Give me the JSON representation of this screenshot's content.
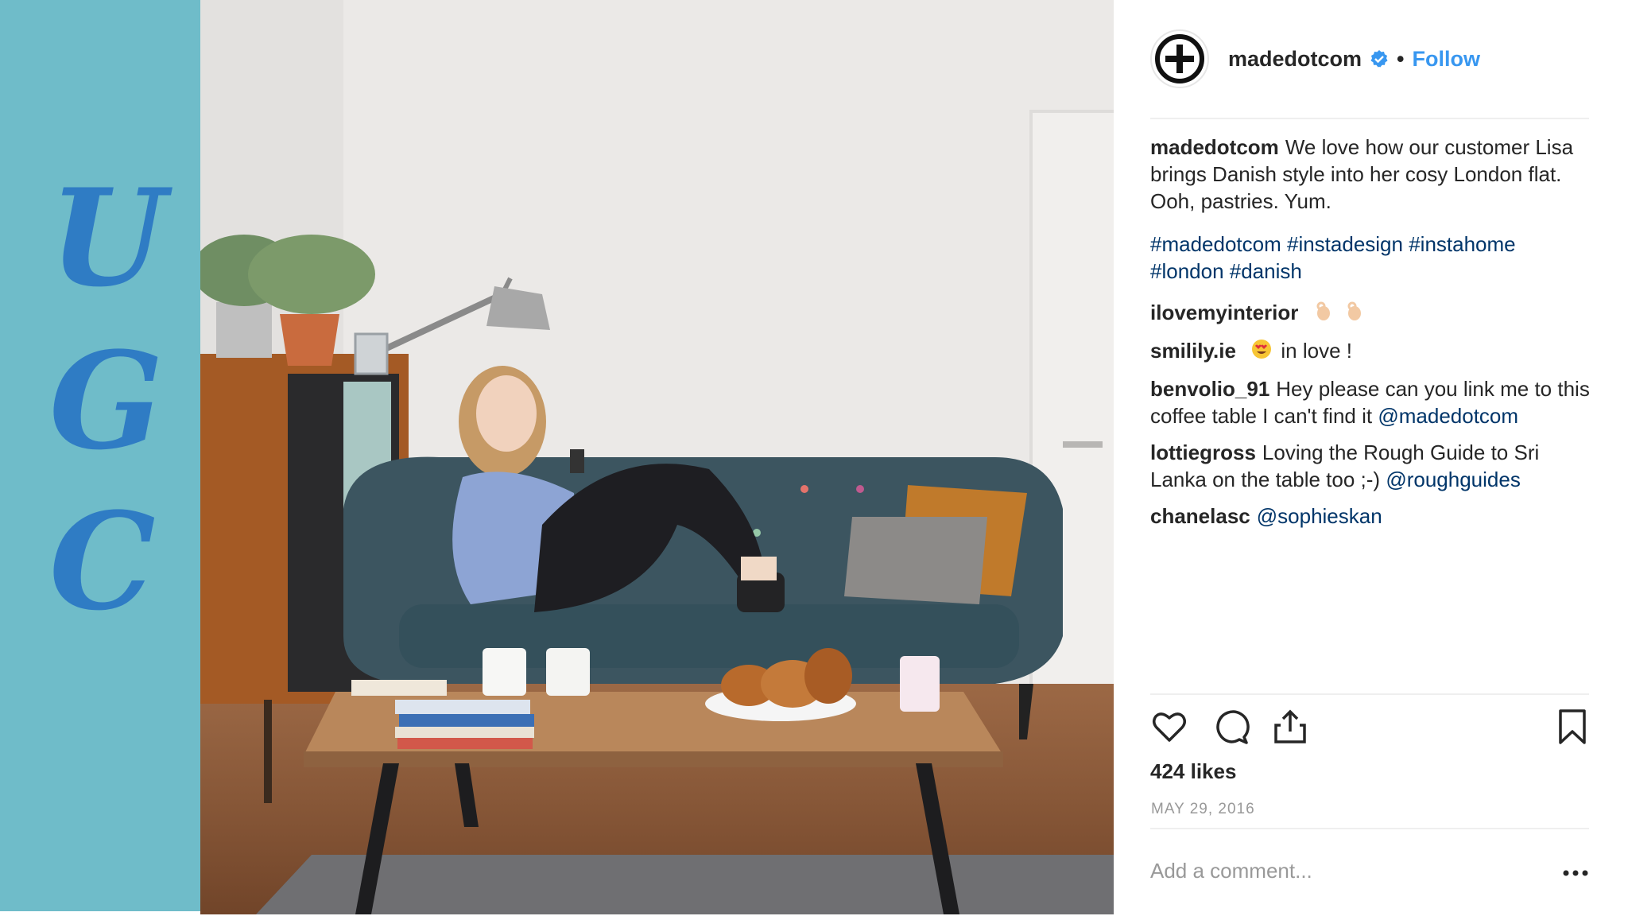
{
  "banner": {
    "letters": [
      "U",
      "G",
      "C"
    ],
    "background_color": "#6fbcc9",
    "letter_color": "#2f7cc4"
  },
  "photo": {
    "description_icon": "living-room-photo"
  },
  "post": {
    "account": "madedotcom",
    "verified": true,
    "separator": "•",
    "follow_label": "Follow",
    "caption": {
      "user": "madedotcom",
      "text": "We love how our customer Lisa brings Danish style into her cosy London flat. Ooh, pastries. Yum.",
      "hashtags": "#madedotcom #instadesign #instahome #london #danish"
    },
    "comments": [
      {
        "user": "ilovemyinterior",
        "text": "",
        "emoji": [
          "ok-hand-emoji",
          "ok-hand-emoji"
        ]
      },
      {
        "user": "smilily.ie",
        "text": "in love !",
        "emoji": [
          "heart-eyes-emoji"
        ]
      },
      {
        "user": "benvolio_91",
        "text": "Hey please can you link me to this coffee table I can't find it",
        "mention": "@madedotcom"
      },
      {
        "user": "lottiegross",
        "text": "Loving the Rough Guide to Sri Lanka on the table too ;-)",
        "mention": "@roughguides"
      },
      {
        "user": "chanelasc",
        "text": "",
        "mention": "@sophieskan"
      }
    ],
    "likes": "424 likes",
    "date": "MAY 29, 2016",
    "comment_placeholder": "Add a comment...",
    "icons": [
      "heart-icon",
      "comment-icon",
      "share-icon",
      "bookmark-icon",
      "more-options-icon"
    ],
    "link_color": "#3897f0",
    "hashtag_color": "#003569"
  }
}
